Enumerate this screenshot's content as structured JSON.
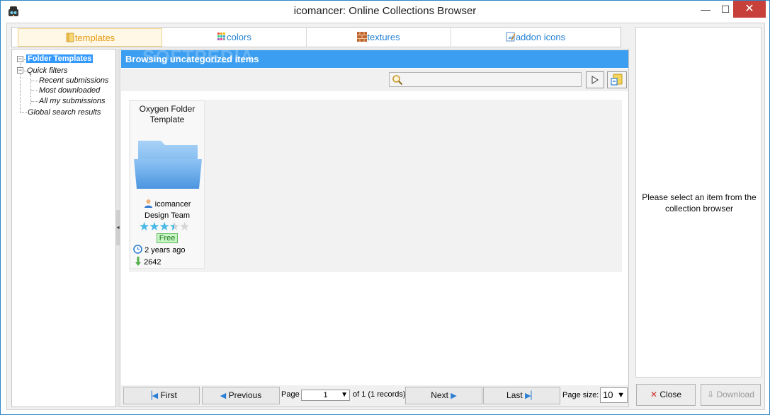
{
  "window": {
    "title": "icomancer: Online Collections Browser",
    "controls": {
      "minimize": "—",
      "maximize": "☐",
      "close": "✕"
    }
  },
  "tabs": [
    {
      "label": "templates",
      "icon": "folder-icon",
      "active": true
    },
    {
      "label": "colors",
      "icon": "color-grid-icon",
      "active": false
    },
    {
      "label": "textures",
      "icon": "brick-texture-icon",
      "active": false
    },
    {
      "label": "addon icons",
      "icon": "image-edit-icon",
      "active": false
    }
  ],
  "tree": {
    "root": "Folder Templates",
    "quick_filters": "Quick filters",
    "children": [
      "Recent submissions",
      "Most downloaded",
      "All my submissions"
    ],
    "global": "Global search results"
  },
  "main": {
    "header": "Browsing uncategorized items",
    "watermark": "SOFTPEDIA",
    "search": {
      "value": "",
      "placeholder": ""
    }
  },
  "item": {
    "title": "Oxygen Folder Template",
    "author": "icomancer",
    "author_team": "Design Team",
    "rating": 3.5,
    "rating_max": 5,
    "price": "Free",
    "age": "2 years ago",
    "downloads": "2642"
  },
  "pager": {
    "first": "First",
    "previous": "Previous",
    "page_label": "Page",
    "page_value": "1",
    "of_text": "of 1 (1 records)",
    "next": "Next",
    "last": "Last",
    "page_size_label": "Page size:",
    "page_size_value": "10"
  },
  "details": {
    "message": "Please select an item from the collection browser"
  },
  "buttons": {
    "close": "Close",
    "download": "Download"
  },
  "colors": {
    "header_blue": "#3c9ef0",
    "tree_selected": "#3399ff",
    "tab_active": "#e59a12",
    "tab_text": "#1f7fd0",
    "star": "#49b8e6",
    "free_badge": "#c8f5c4"
  }
}
